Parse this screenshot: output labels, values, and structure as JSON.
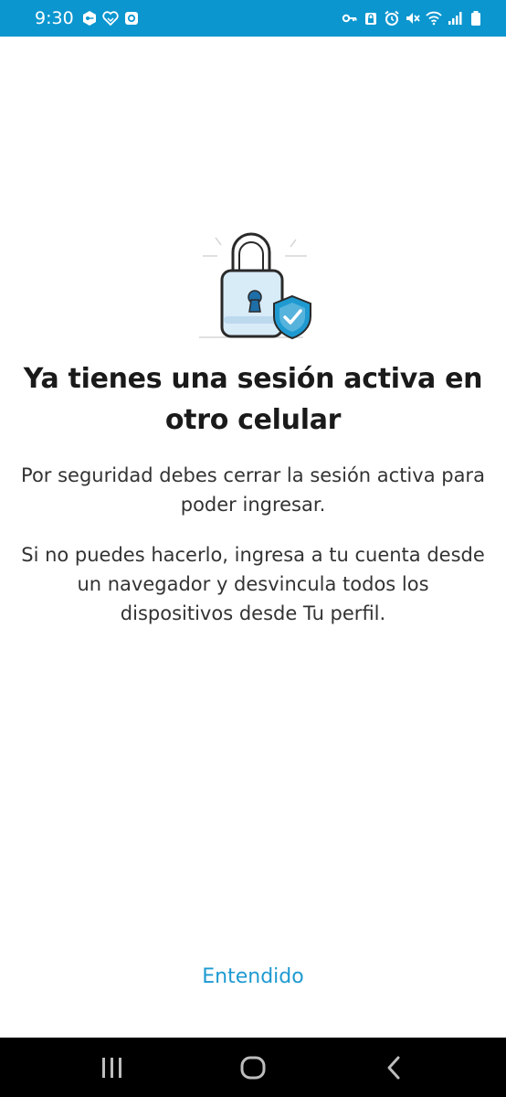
{
  "status_bar": {
    "time": "9:30",
    "background": "#0b96cf",
    "left_icons": [
      "vpn-key-icon",
      "heart-handshake-icon",
      "app-notification-icon"
    ],
    "right_icons": [
      "key-icon",
      "alarm-lock-icon",
      "alarm-clock-icon",
      "mute-icon",
      "wifi-icon",
      "signal-icon",
      "battery-icon"
    ]
  },
  "illustration": {
    "icon": "lock-shield-icon",
    "accent": "#1e9ad1",
    "fill": "#d8ecf8"
  },
  "dialog": {
    "title": "Ya tienes una sesión activa en otro celular",
    "paragraph_1": "Por seguridad debes cerrar la sesión activa para poder ingresar.",
    "paragraph_2": "Si no puedes hacerlo, ingresa a tu cuenta desde un navegador y desvincula todos los dispositivos desde Tu perfil."
  },
  "actions": {
    "primary_label": "Entendido",
    "primary_color": "#1e9ad1"
  },
  "nav_bar": {
    "buttons": [
      "recents-icon",
      "home-icon",
      "back-icon"
    ]
  }
}
